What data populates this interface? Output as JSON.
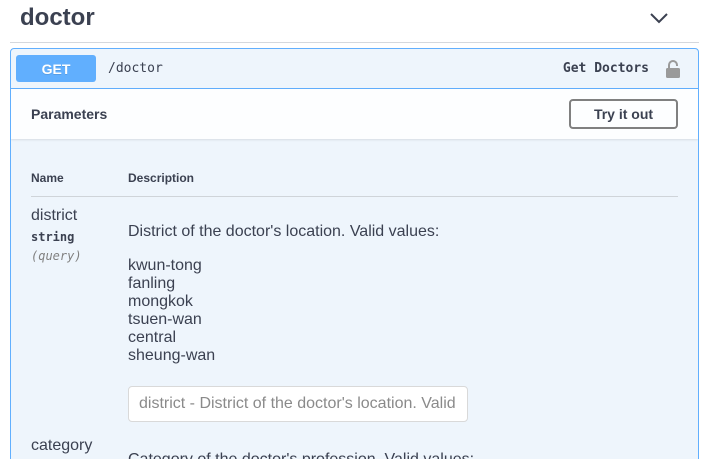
{
  "tag": {
    "title": "doctor",
    "toggle_icon": "chevron-down-icon"
  },
  "operation": {
    "method": "GET",
    "path": "/doctor",
    "summary": "Get Doctors",
    "lock_icon": "lock-icon",
    "colors": {
      "accent": "#61affe",
      "background": "#eef5fc"
    }
  },
  "parameters_section": {
    "title": "Parameters",
    "try_button_label": "Try it out",
    "columns": {
      "name": "Name",
      "description": "Description"
    },
    "params": [
      {
        "name": "district",
        "type": "string",
        "in": "(query)",
        "description": "District of the doctor's location. Valid values:",
        "values": [
          "kwun-tong",
          "fanling",
          "mongkok",
          "tsuen-wan",
          "central",
          "sheung-wan"
        ],
        "placeholder": "district - District of the doctor's location. Valid values: kwun-tong, fanling, mongkok, tsuen-wan, central, sheung-wan"
      },
      {
        "name": "category",
        "description": "Category of the doctor's profession. Valid values:"
      }
    ]
  }
}
